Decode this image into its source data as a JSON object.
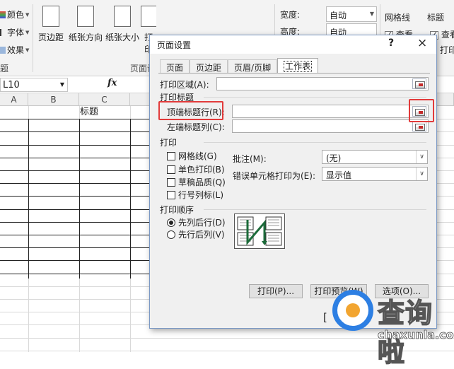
{
  "ribbon": {
    "theme": {
      "colors": "颜色",
      "fonts": "字体",
      "effects": "效果",
      "group_stub": "题"
    },
    "page_setup": {
      "margins": "页边距",
      "orientation": "纸张方向",
      "size": "纸张大小",
      "print_area_stub": "打印",
      "group_label": "页面设"
    },
    "scale": {
      "width_label": "宽度:",
      "width_value": "自动",
      "height_label": "高度:",
      "height_value": "自动"
    },
    "sheet_options": {
      "gridlines_label": "网格线",
      "gridlines_view": "查看",
      "headings_label": "标题",
      "headings_view": "查看",
      "print_stub": "打印"
    }
  },
  "formula_bar": {
    "name_box": "L10",
    "fx": "fx"
  },
  "sheet": {
    "columns": [
      "A",
      "B",
      "C"
    ],
    "title_cell": "标题"
  },
  "dialog": {
    "title": "页面设置",
    "help": "?",
    "close": "×",
    "tabs": [
      "页面",
      "页边距",
      "页眉/页脚",
      "工作表"
    ],
    "print_area_label": "打印区域(A):",
    "print_titles_section": "打印标题",
    "rows_to_repeat_label": "顶端标题行(R):",
    "cols_to_repeat_label": "左端标题列(C):",
    "print_section": "打印",
    "checkboxes": [
      "网格线(G)",
      "单色打印(B)",
      "草稿品质(Q)",
      "行号列标(L)"
    ],
    "comments_label": "批注(M):",
    "comments_value": "(无)",
    "errors_label": "错误单元格打印为(E):",
    "errors_value": "显示值",
    "page_order_section": "打印顺序",
    "order_options": [
      "先列后行(D)",
      "先行后列(V)"
    ],
    "buttons": {
      "print": "打印(P)...",
      "preview": "打印预览(W)",
      "options": "选项(O)..."
    },
    "ok_stub": "["
  },
  "watermark": {
    "brand": "查询啦",
    "url": "chaxunla.com"
  },
  "colors": {
    "highlight": "#e23b3b",
    "brand_blue": "#2d7fe3",
    "brand_orange": "#f2a531"
  }
}
